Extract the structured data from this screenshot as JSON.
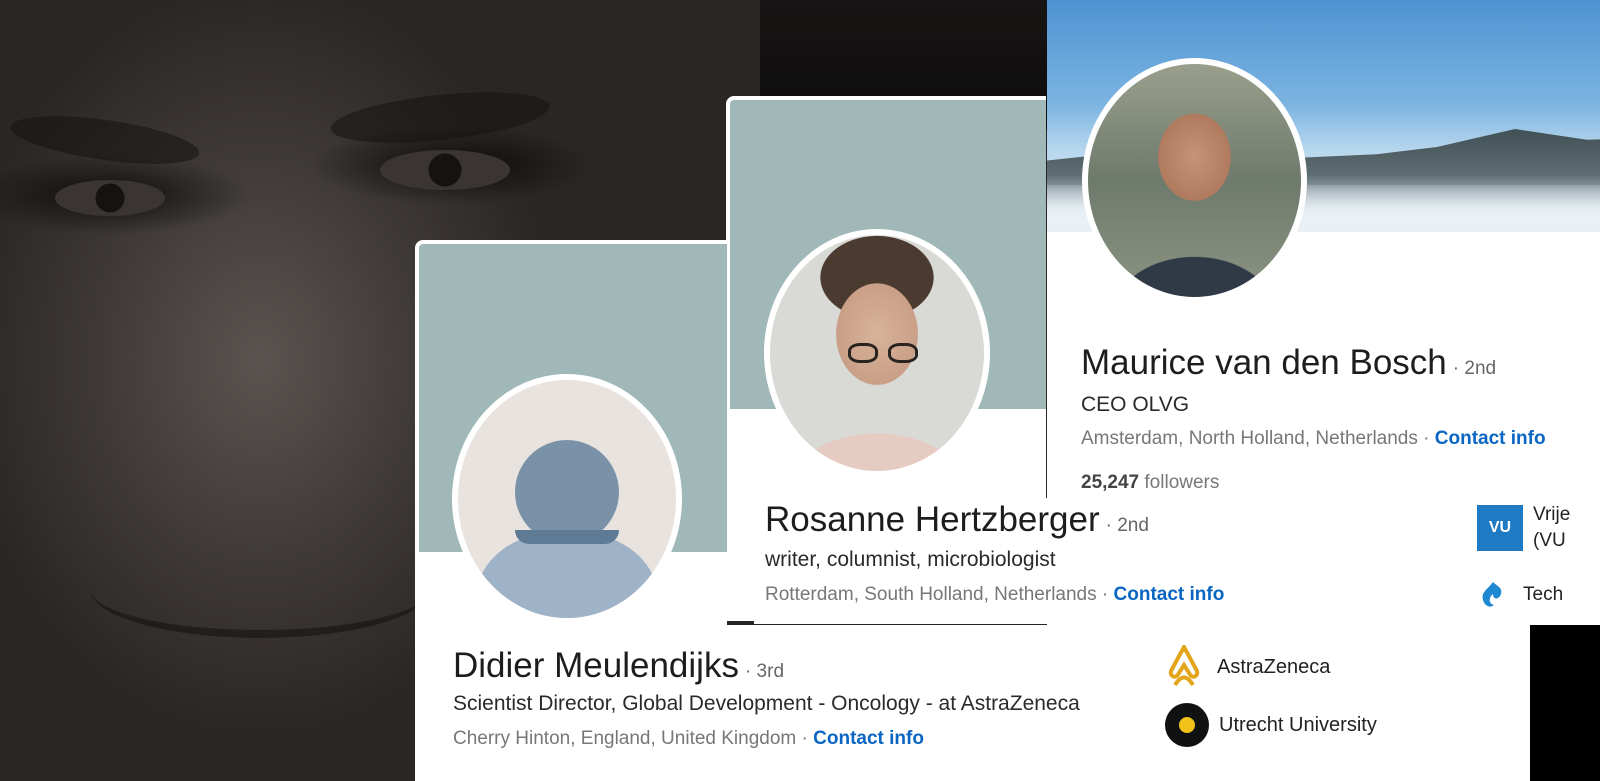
{
  "profiles": {
    "maurice": {
      "name": "Maurice van den Bosch",
      "degree": "· 2nd",
      "headline": "CEO OLVG",
      "location": "Amsterdam, North Holland, Netherlands",
      "separator": "·",
      "contact": "Contact info",
      "followers_count": "25,247",
      "followers_label": "followers",
      "orgs": [
        {
          "logo": "VU",
          "name_line1": "Vrije",
          "name_line2": "(VU"
        },
        {
          "logo": "tech-flame-icon",
          "name": "Tech"
        }
      ]
    },
    "rosanne": {
      "name": "Rosanne Hertzberger",
      "degree": "· 2nd",
      "headline": "writer, columnist, microbiologist",
      "location": "Rotterdam, South Holland, Netherlands",
      "separator": "·",
      "contact": "Contact info"
    },
    "didier": {
      "name": "Didier Meulendijks",
      "degree": "· 3rd",
      "headline": "Scientist Director, Global Development - Oncology - at AstraZeneca",
      "location": "Cherry Hinton, England, United Kingdom",
      "separator": "·",
      "contact": "Contact info",
      "orgs": [
        {
          "logo": "astrazeneca-logo",
          "name": "AstraZeneca"
        },
        {
          "logo": "utrecht-university-logo",
          "name": "Utrecht University"
        }
      ]
    }
  },
  "colors": {
    "link": "#0a66c2",
    "banner_placeholder": "#a0b8b8",
    "vu_blue": "#1e7ac2",
    "az_gold": "#e3a51a"
  }
}
